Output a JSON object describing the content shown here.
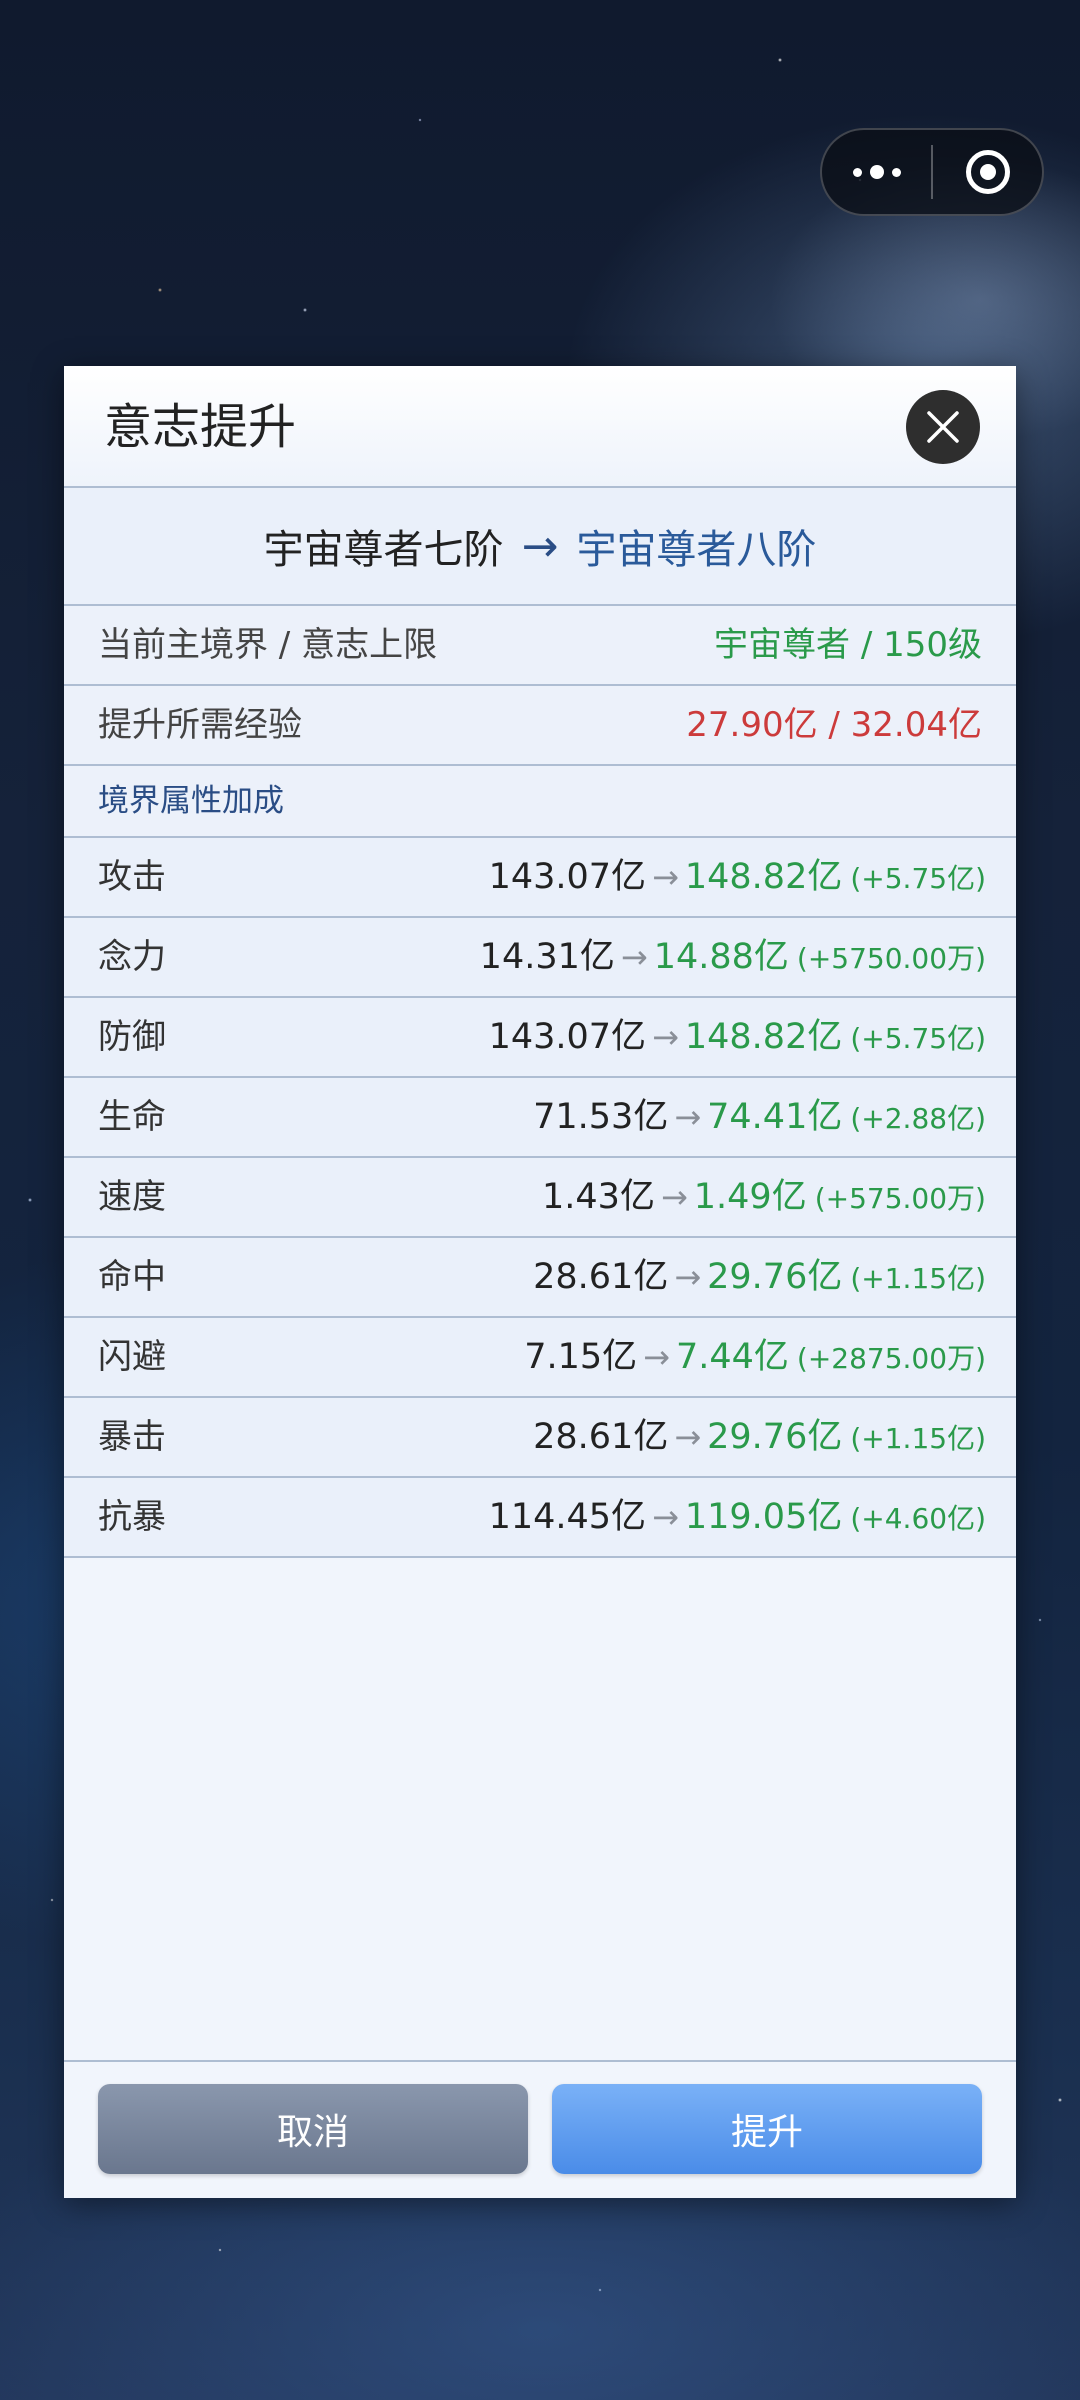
{
  "dialog": {
    "title": "意志提升",
    "transition": {
      "from": "宇宙尊者七阶",
      "arrow": "→",
      "to": "宇宙尊者八阶"
    },
    "info_rows": [
      {
        "label": "当前主境界 / 意志上限",
        "value": "宇宙尊者 / 150级",
        "color": "#2a9a4a"
      },
      {
        "label": "提升所需经验",
        "value": "27.90亿 / 32.04亿",
        "color": "#cc3b3b"
      }
    ],
    "section_title": "境界属性加成",
    "stats": [
      {
        "name": "攻击",
        "from": "143.07亿",
        "to": "148.82亿",
        "delta": "(+5.75亿)"
      },
      {
        "name": "念力",
        "from": "14.31亿",
        "to": "14.88亿",
        "delta": "(+5750.00万)"
      },
      {
        "name": "防御",
        "from": "143.07亿",
        "to": "148.82亿",
        "delta": "(+5.75亿)"
      },
      {
        "name": "生命",
        "from": "71.53亿",
        "to": "74.41亿",
        "delta": "(+2.88亿)"
      },
      {
        "name": "速度",
        "from": "1.43亿",
        "to": "1.49亿",
        "delta": "(+575.00万)"
      },
      {
        "name": "命中",
        "from": "28.61亿",
        "to": "29.76亿",
        "delta": "(+1.15亿)"
      },
      {
        "name": "闪避",
        "from": "7.15亿",
        "to": "7.44亿",
        "delta": "(+2875.00万)"
      },
      {
        "name": "暴击",
        "from": "28.61亿",
        "to": "29.76亿",
        "delta": "(+1.15亿)"
      },
      {
        "name": "抗暴",
        "from": "114.45亿",
        "to": "119.05亿",
        "delta": "(+4.60亿)"
      }
    ],
    "stat_arrow": "→",
    "buttons": {
      "cancel": "取消",
      "upgrade": "提升"
    }
  },
  "capsule": {
    "menu_icon": "more-dots-icon",
    "close_icon": "target-circle-icon"
  },
  "colors": {
    "gain": "#2a9a4a",
    "cost": "#cc3b3b",
    "accent": "#2a5a9a",
    "upgrade_button": "#4a8ce8",
    "cancel_button": "#6a778e"
  }
}
